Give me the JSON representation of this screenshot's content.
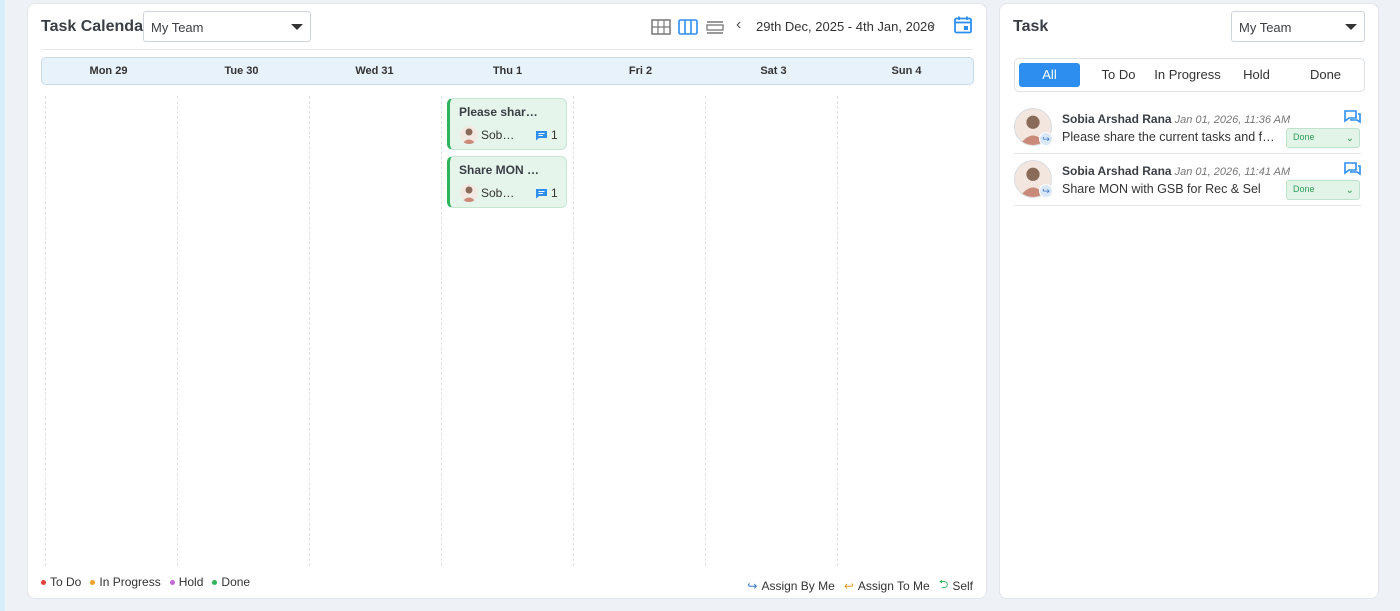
{
  "calendar": {
    "title": "Task Calendar",
    "team_select": "My Team",
    "date_range": "29th Dec, 2025 - 4th Jan, 2026",
    "days": [
      "Mon 29",
      "Tue 30",
      "Wed 31",
      "Thu 1",
      "Fri 2",
      "Sat 3",
      "Sun 4"
    ],
    "tasks": [
      {
        "day": "Thu 1",
        "title": "Please shar…",
        "user": "Sob…",
        "comments": "1",
        "status": "Done"
      },
      {
        "day": "Thu 1",
        "title": "Share MON …",
        "user": "Sob…",
        "comments": "1",
        "status": "Done"
      }
    ],
    "legend": [
      {
        "label": "To Do",
        "color": "#e5413b"
      },
      {
        "label": "In Progress",
        "color": "#f0a030"
      },
      {
        "label": "Hold",
        "color": "#c46ad6"
      },
      {
        "label": "Done",
        "color": "#2fb35c"
      }
    ],
    "assign_legend": [
      {
        "label": "Assign By Me",
        "icon": "arrow-right-icon",
        "color": "#3a78c4"
      },
      {
        "label": "Assign To Me",
        "icon": "arrow-left-icon",
        "color": "#e8a030"
      },
      {
        "label": "Self",
        "icon": "arrow-return-icon",
        "color": "#2fb35c"
      }
    ]
  },
  "task_panel": {
    "title": "Task",
    "team_select": "My Team",
    "tabs": [
      "All",
      "To Do",
      "In Progress",
      "Hold",
      "Done"
    ],
    "active_tab": "All",
    "items": [
      {
        "name": "Sobia Arshad Rana",
        "time": "Jan 01, 2026, 11:36 AM",
        "desc": "Please share the current tasks and future",
        "status": "Done"
      },
      {
        "name": "Sobia Arshad Rana",
        "time": "Jan 01, 2026, 11:41 AM",
        "desc": "Share MON with GSB for Rec & Sel",
        "status": "Done"
      }
    ]
  },
  "colors": {
    "accent": "#2d8ef0",
    "done": "#2fb35c",
    "done_bg": "#e6f5ec"
  }
}
